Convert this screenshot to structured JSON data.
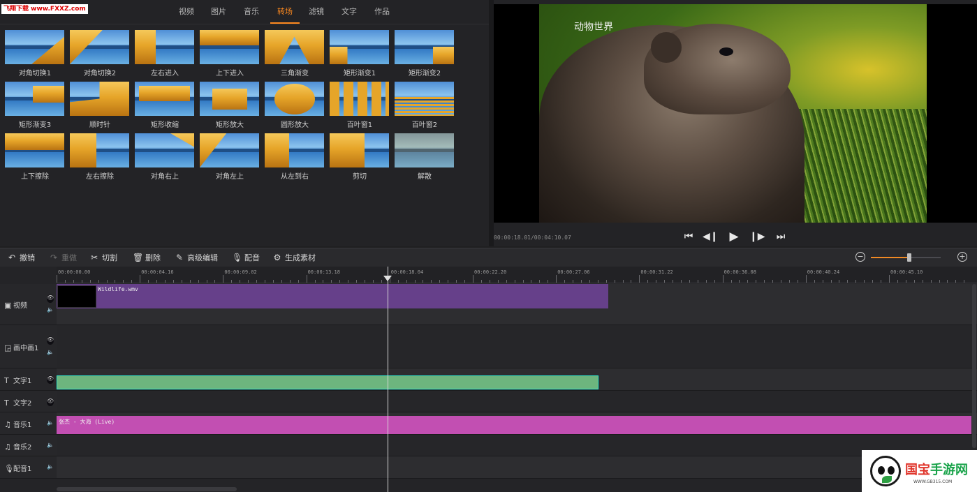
{
  "watermark_top": "飞翔下载 www.FXXZ.com",
  "tabs": [
    "视频",
    "图片",
    "音乐",
    "转场",
    "滤镜",
    "文字",
    "作品"
  ],
  "active_tab": "转场",
  "transitions": [
    "对角切换1",
    "对角切换2",
    "左右进入",
    "上下进入",
    "三角渐变",
    "矩形渐变1",
    "矩形渐变2",
    "矩形渐变3",
    "顺时针",
    "矩形收缩",
    "矩形放大",
    "圆形放大",
    "百叶窗1",
    "百叶窗2",
    "上下擦除",
    "左右擦除",
    "对角右上",
    "对角左上",
    "从左到右",
    "剪切",
    "解散"
  ],
  "preview": {
    "caption": "动物世界",
    "timecode": "00:00:18.01/00:04:10.07"
  },
  "toolbar": {
    "undo": "撤销",
    "redo": "重做",
    "cut": "切割",
    "delete": "删除",
    "advanced_edit": "高级编辑",
    "dub": "配音",
    "generate": "生成素材"
  },
  "zoom_level": 0.55,
  "ruler_labels": [
    "00:00:00.00",
    "00:00:04.16",
    "00:00:09.02",
    "00:00:13.18",
    "00:00:18.04",
    "00:00:22.20",
    "00:00:27.06",
    "00:00:31.22",
    "00:00:36.08",
    "00:00:40.24",
    "00:00:45.10"
  ],
  "tracks": {
    "video": "视频",
    "pip": "画中画1",
    "text1": "文字1",
    "text2": "文字2",
    "music1": "音乐1",
    "music2": "音乐2",
    "dub1": "配音1"
  },
  "clips": {
    "video_clip": "Wildlife.wmv",
    "music_clip": "张杰 - 大海 (Live)"
  },
  "watermark_br": {
    "brand_a": "国宝",
    "brand_b": "手游网",
    "url": "WWW.GB315.COM"
  },
  "colors": {
    "accent": "#ff8a1f",
    "video_clip": "#66408a",
    "text_clip": "#6db57e",
    "music_clip": "#c24fb2"
  }
}
